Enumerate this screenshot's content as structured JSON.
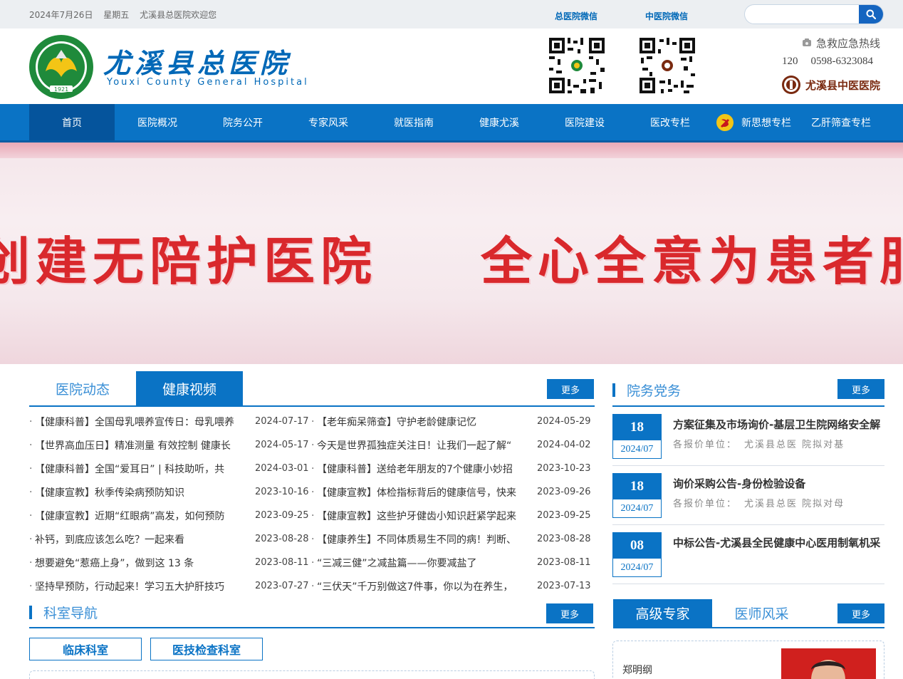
{
  "topbar": {
    "date": "2024年7月26日",
    "weekday": "星期五",
    "welcome": "尤溪县总医院欢迎您",
    "wechat_general": "总医院微信",
    "wechat_tcm": "中医院微信",
    "search_placeholder": ""
  },
  "header": {
    "logo_cn": "尤溪县总医院",
    "logo_en": "Youxi County General Hospital",
    "emblem_year": "1921",
    "hotline_title": "急救应急热线",
    "hotline_short": "120",
    "hotline_long": "0598-6323084",
    "tcm_link": "尤溪县中医医院"
  },
  "nav": [
    "首页",
    "医院概况",
    "院务公开",
    "专家风采",
    "就医指南",
    "健康尤溪",
    "医院建设",
    "医改专栏",
    "新思想专栏",
    "乙肝筛查专栏"
  ],
  "banner": {
    "text_left": "创建无陪护医院",
    "text_right": "全心全意为患者服务"
  },
  "news": {
    "tabs": [
      "医院动态",
      "健康视频"
    ],
    "more": "更多",
    "left": [
      {
        "title": "【健康科普】全国母乳喂养宣传日：母乳喂养",
        "date": "2024-07-17"
      },
      {
        "title": "【世界高血压日】精准测量 有效控制 健康长",
        "date": "2024-05-17"
      },
      {
        "title": "【健康科普】全国“爱耳日” | 科技助听，共",
        "date": "2024-03-01"
      },
      {
        "title": "【健康宣教】秋季传染病预防知识",
        "date": "2023-10-16"
      },
      {
        "title": "【健康宣教】近期“红眼病”高发，如何预防",
        "date": "2023-09-25"
      },
      {
        "title": "补钙，到底应该怎么吃？一起来看",
        "date": "2023-08-28"
      },
      {
        "title": "想要避免“惹癌上身”，做到这 13 条",
        "date": "2023-08-11"
      },
      {
        "title": "坚持早预防，行动起来！学习五大护肝技巧",
        "date": "2023-07-27"
      }
    ],
    "right": [
      {
        "title": "【老年痴呆筛查】守护老龄健康记忆",
        "date": "2024-05-29"
      },
      {
        "title": "今天是世界孤独症关注日！让我们一起了解“",
        "date": "2024-04-02"
      },
      {
        "title": "【健康科普】送给老年朋友的7个健康小妙招",
        "date": "2023-10-23"
      },
      {
        "title": "【健康宣教】体检指标背后的健康信号，快来",
        "date": "2023-09-26"
      },
      {
        "title": "【健康宣教】这些护牙健齿小知识赶紧学起来",
        "date": "2023-09-25"
      },
      {
        "title": "【健康养生】不同体质易生不同的病！判断、",
        "date": "2023-08-28"
      },
      {
        "title": "“三减三健”之减盐篇——你要减盐了",
        "date": "2023-08-11"
      },
      {
        "title": "“三伏天”千万别做这7件事，你以为在养生，",
        "date": "2023-07-13"
      }
    ]
  },
  "party": {
    "title": "院务党务",
    "more": "更多",
    "items": [
      {
        "day": "18",
        "ym": "2024/07",
        "title": "方案征集及市场询价-基层卫生院网络安全解",
        "meta_label": "各报价单位：",
        "meta_value": "尤溪县总医 院拟对基"
      },
      {
        "day": "18",
        "ym": "2024/07",
        "title": "询价采购公告-身份检验设备",
        "meta_label": "各报价单位：",
        "meta_value": "尤溪县总医 院拟对母"
      },
      {
        "day": "08",
        "ym": "2024/07",
        "title": "中标公告-尤溪县全民健康中心医用制氧机采",
        "meta_label": "",
        "meta_value": ""
      }
    ]
  },
  "dept": {
    "title": "科室导航",
    "more": "更多",
    "buttons": [
      "临床科室",
      "医技检查科室"
    ]
  },
  "experts": {
    "tabs": [
      "高级专家",
      "医师风采"
    ],
    "more": "更多",
    "name": "郑明纲"
  },
  "colors": {
    "primary": "#0a73c5",
    "nav_active": "#05549c",
    "banner_red": "#d9282c"
  }
}
